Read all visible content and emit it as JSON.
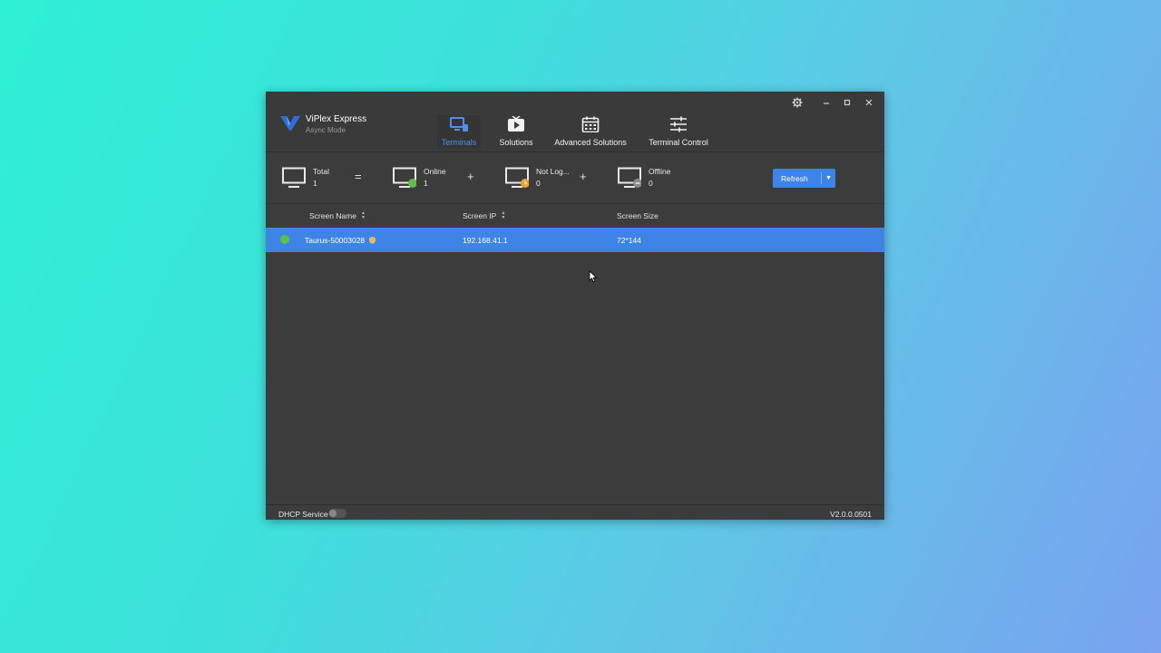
{
  "app": {
    "title": "ViPlex Express",
    "mode": "Async Mode"
  },
  "window_controls": [
    "settings-icon",
    "minimize-icon",
    "maximize-icon",
    "close-icon"
  ],
  "nav_tabs": [
    {
      "label": "Terminals",
      "icon": "terminals-icon",
      "active": true
    },
    {
      "label": "Solutions",
      "icon": "solutions-icon",
      "active": false
    },
    {
      "label": "Advanced Solutions",
      "icon": "calendar-icon",
      "active": false
    },
    {
      "label": "Terminal Control",
      "icon": "sliders-icon",
      "active": false
    }
  ],
  "summary": {
    "total": {
      "label": "Total",
      "count": "1"
    },
    "online": {
      "label": "Online",
      "count": "1"
    },
    "not_logged": {
      "label": "Not Log...",
      "count": "0"
    },
    "offline": {
      "label": "Offline",
      "count": "0"
    },
    "operators": [
      "=",
      "+",
      "+"
    ]
  },
  "refresh_button": {
    "label": "Refresh"
  },
  "table": {
    "columns": [
      "Screen Name",
      "Screen IP",
      "Screen Size"
    ],
    "rows": [
      {
        "status": "online",
        "name": "Taurus-50003028",
        "ip": "192.168.41.1",
        "size": "72*144"
      }
    ]
  },
  "footer": {
    "dhcp_label": "DHCP Service",
    "dhcp_enabled": false,
    "version": "V2.0.0.0501"
  },
  "colors": {
    "accent": "#3d84e6",
    "online": "#5cc04a",
    "not_logged": "#e8a33a",
    "offline": "#8a8a8a",
    "window_bg": "#3c3c3c"
  }
}
